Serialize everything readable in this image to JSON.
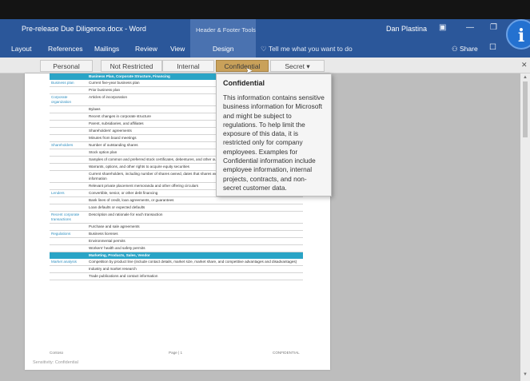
{
  "titlebar": {
    "doc_title": "Pre-release Due Diligence.docx - Word",
    "contextual_group": "Header & Footer Tools",
    "user": "Dan Plastina",
    "minimize": "—"
  },
  "ribbon": {
    "tabs": [
      "Layout",
      "References",
      "Mailings",
      "Review",
      "View"
    ],
    "active_tab": "Design",
    "tell_me": "Tell me what you want to do",
    "share": "Share"
  },
  "sensitivity_bar": {
    "labels": [
      "Personal",
      "Not Restricted",
      "Internal",
      "Confidential",
      "Secret"
    ],
    "secret_dropdown": "▾",
    "selected": "Confidential"
  },
  "tooltip": {
    "title": "Confidential",
    "body": "This information contains sensitive business information for Microsoft and might be subject to regulations. To help limit the exposure of this data, it is restricted only for company employees. Examples for Confidential information include employee information, internal projects, contracts, and non-secret customer data."
  },
  "document": {
    "rows": [
      {
        "band": true,
        "item": "Business Plan, Corporate Structure, Financing"
      },
      {
        "cat": "Business plan",
        "item": "Current five-year business plan"
      },
      {
        "cat": "",
        "item": "Prior business plan"
      },
      {
        "cat": "Corporate organization",
        "item": "Articles of incorporation"
      },
      {
        "cat": "",
        "item": "Bylaws"
      },
      {
        "cat": "",
        "item": "Recent changes in corporate structure"
      },
      {
        "cat": "",
        "item": "Parent, subsidiaries, and affiliates"
      },
      {
        "cat": "",
        "item": "Shareholders' agreements"
      },
      {
        "cat": "",
        "item": "Minutes from board meetings"
      },
      {
        "cat": "Shareholders",
        "item": "Number of outstanding shares"
      },
      {
        "cat": "",
        "item": "Stock option plan"
      },
      {
        "cat": "",
        "item": "Samples of common and preferred stock certificates, debentures, and other outstanding securities"
      },
      {
        "cat": "",
        "item": "Warrants, options, and other rights to acquire equity securities"
      },
      {
        "cat": "",
        "item": "Current shareholders, including number of shares owned, dates that shares were acquired, consideration received, and contact information"
      },
      {
        "cat": "",
        "item": "Relevant private placement memoranda and other offering circulars"
      },
      {
        "cat": "Lenders",
        "item": "Convertible, senior, or other debt financing"
      },
      {
        "cat": "",
        "item": "Bank lines of credit, loan agreements, or guarantees"
      },
      {
        "cat": "",
        "item": "Loan defaults or expected defaults"
      },
      {
        "cat": "Recent corporate transactions",
        "item": "Description and rationale for each transaction"
      },
      {
        "cat": "",
        "item": "Purchase and sale agreements"
      },
      {
        "cat": "Regulations",
        "item": "Business licenses"
      },
      {
        "cat": "",
        "item": "Environmental permits"
      },
      {
        "cat": "",
        "item": "Workers' health and safety permits"
      },
      {
        "band": true,
        "item": "Marketing, Products, Sales, Vendor"
      },
      {
        "cat": "Market analysis",
        "item": "Competition by product line (include contact details, market size, market share, and competitive advantages and disadvantages)"
      },
      {
        "cat": "",
        "item": "Industry and market research"
      },
      {
        "cat": "",
        "item": "Trade publications and contact information"
      }
    ],
    "footer_left": "Contoso",
    "footer_center": "Page | 1",
    "footer_right": "CONFIDENTIAL",
    "sensitivity_label": "Sensitivity: Confidential"
  },
  "colors": {
    "ribbon": "#2b579a",
    "table_band": "#2aa4c6",
    "confidential": "#c9a15a"
  }
}
